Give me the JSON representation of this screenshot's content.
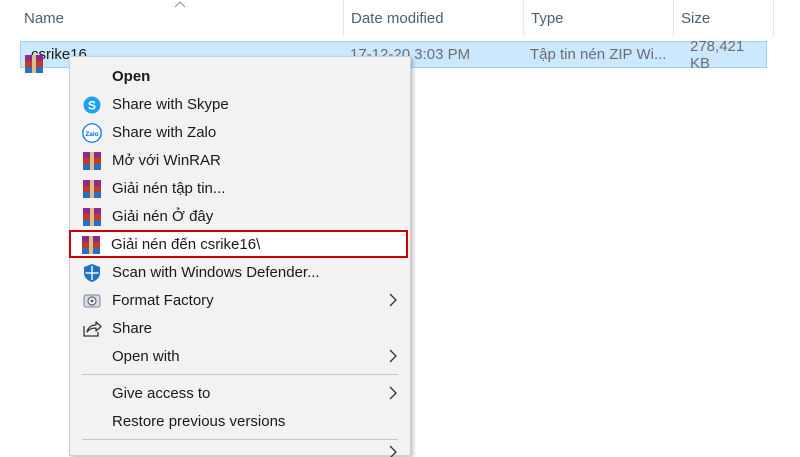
{
  "columns": {
    "name": "Name",
    "date_modified": "Date modified",
    "type": "Type",
    "size": "Size"
  },
  "file": {
    "name": "csrike16",
    "date": "17-12-20 3:03 PM",
    "type": "Tập tin nén ZIP Wi...",
    "size": "278,421 KB"
  },
  "menu": {
    "open": "Open",
    "share_skype": "Share with Skype",
    "share_zalo": "Share with Zalo",
    "open_winrar": "Mở với WinRAR",
    "extract_files": "Giải nén tập tin...",
    "extract_here": "Giải nén Ở đây",
    "extract_to": "Giải nén đến csrike16\\",
    "scan_defender": "Scan with Windows Defender...",
    "format_factory": "Format Factory",
    "share": "Share",
    "open_with": "Open with",
    "give_access": "Give access to",
    "restore_versions": "Restore previous versions"
  },
  "icons": {
    "skype": "skype-icon",
    "zalo": "zalo-icon",
    "winrar": "winrar-icon",
    "defender": "windows-defender-icon",
    "format_factory": "format-factory-icon",
    "share": "share-icon",
    "chevron": "chevron-right-icon"
  },
  "colors": {
    "selection_bg": "#cce8ff",
    "selection_border": "#99d1ff",
    "highlight_outline": "#cc0000",
    "menu_bg": "#f2f2f2",
    "header_text": "#4c607a"
  }
}
